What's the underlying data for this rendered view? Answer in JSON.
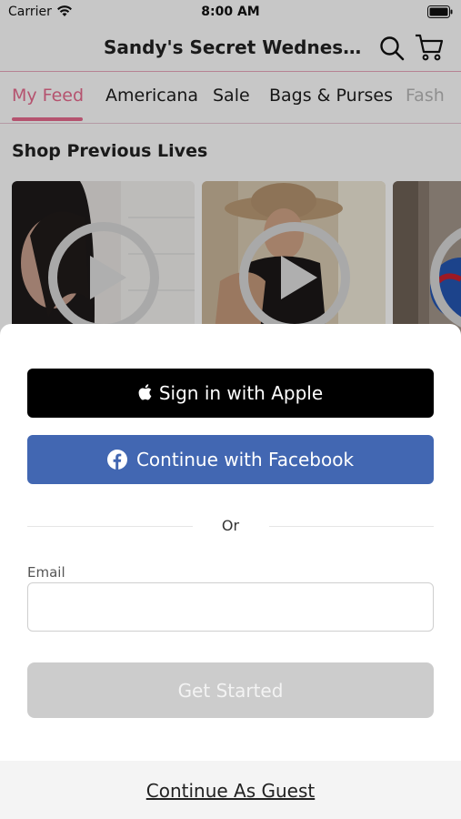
{
  "status_bar": {
    "carrier": "Carrier",
    "time": "8:00 AM"
  },
  "header": {
    "title": "Sandy's Secret Wednesd...",
    "icons": [
      "search-icon",
      "cart-icon"
    ]
  },
  "tabs": [
    {
      "label": "My Feed",
      "active": true
    },
    {
      "label": "Americana",
      "active": false
    },
    {
      "label": "Sale",
      "active": false
    },
    {
      "label": "Bags & Purses",
      "active": false
    },
    {
      "label": "Fash",
      "active": false
    }
  ],
  "section": {
    "title": "Shop Previous Lives"
  },
  "colors": {
    "accent": "#e86b8f",
    "apple_button": "#000000",
    "facebook_button": "#4267b2",
    "disabled_button": "#cccccc",
    "guest_bar": "#f4f4f4"
  },
  "auth": {
    "apple_label": "Sign in with Apple",
    "facebook_label": "Continue with Facebook",
    "divider_text": "Or",
    "email_label": "Email",
    "email_value": "",
    "email_placeholder": "",
    "get_started_label": "Get Started",
    "guest_label": "Continue As Guest"
  }
}
